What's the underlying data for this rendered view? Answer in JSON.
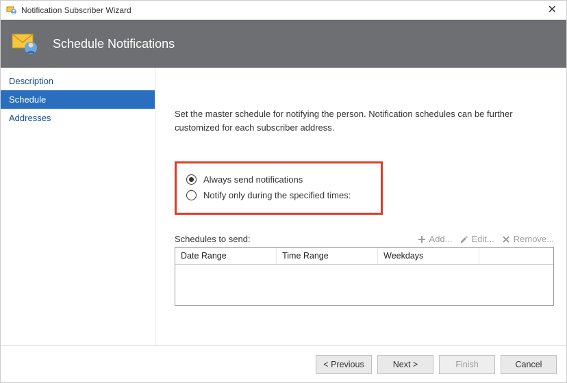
{
  "window": {
    "title": "Notification Subscriber Wizard"
  },
  "header": {
    "title": "Schedule Notifications"
  },
  "sidebar": {
    "items": [
      {
        "label": "Description"
      },
      {
        "label": "Schedule"
      },
      {
        "label": "Addresses"
      }
    ]
  },
  "content": {
    "instructions": "Set the master schedule for notifying the person. Notification schedules can be further customized for each subscriber address.",
    "radio_always": "Always send notifications",
    "radio_specified": "Notify only during the specified times:",
    "schedules_label": "Schedules to send:",
    "toolbar": {
      "add": "Add...",
      "edit": "Edit...",
      "remove": "Remove..."
    },
    "columns": {
      "col1": "Date Range",
      "col2": "Time Range",
      "col3": "Weekdays"
    }
  },
  "footer": {
    "previous": "< Previous",
    "next": "Next >",
    "finish": "Finish",
    "cancel": "Cancel"
  }
}
